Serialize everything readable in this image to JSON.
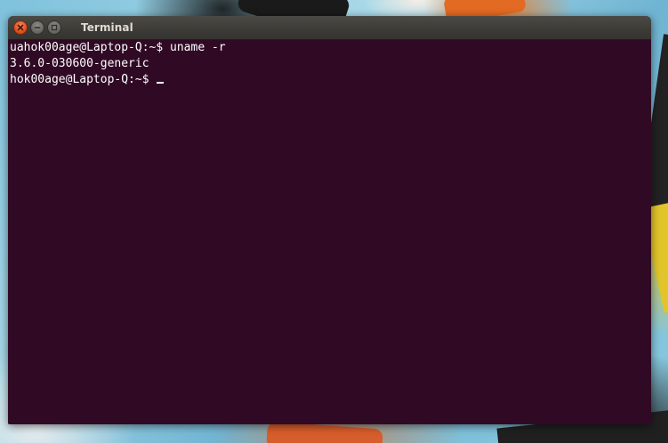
{
  "window": {
    "title": "Terminal"
  },
  "terminal": {
    "lines": [
      "uahok00age@Laptop-Q:~$ uname -r",
      "3.6.0-030600-generic",
      "hok00age@Laptop-Q:~$ "
    ]
  },
  "icons": {
    "close": "close-icon",
    "minimize": "minimize-icon",
    "maximize": "maximize-icon"
  },
  "colors": {
    "terminal_background": "#300a24",
    "terminal_text": "#ffffff",
    "titlebar": "#3d3c38",
    "close_button": "#e2511f"
  }
}
